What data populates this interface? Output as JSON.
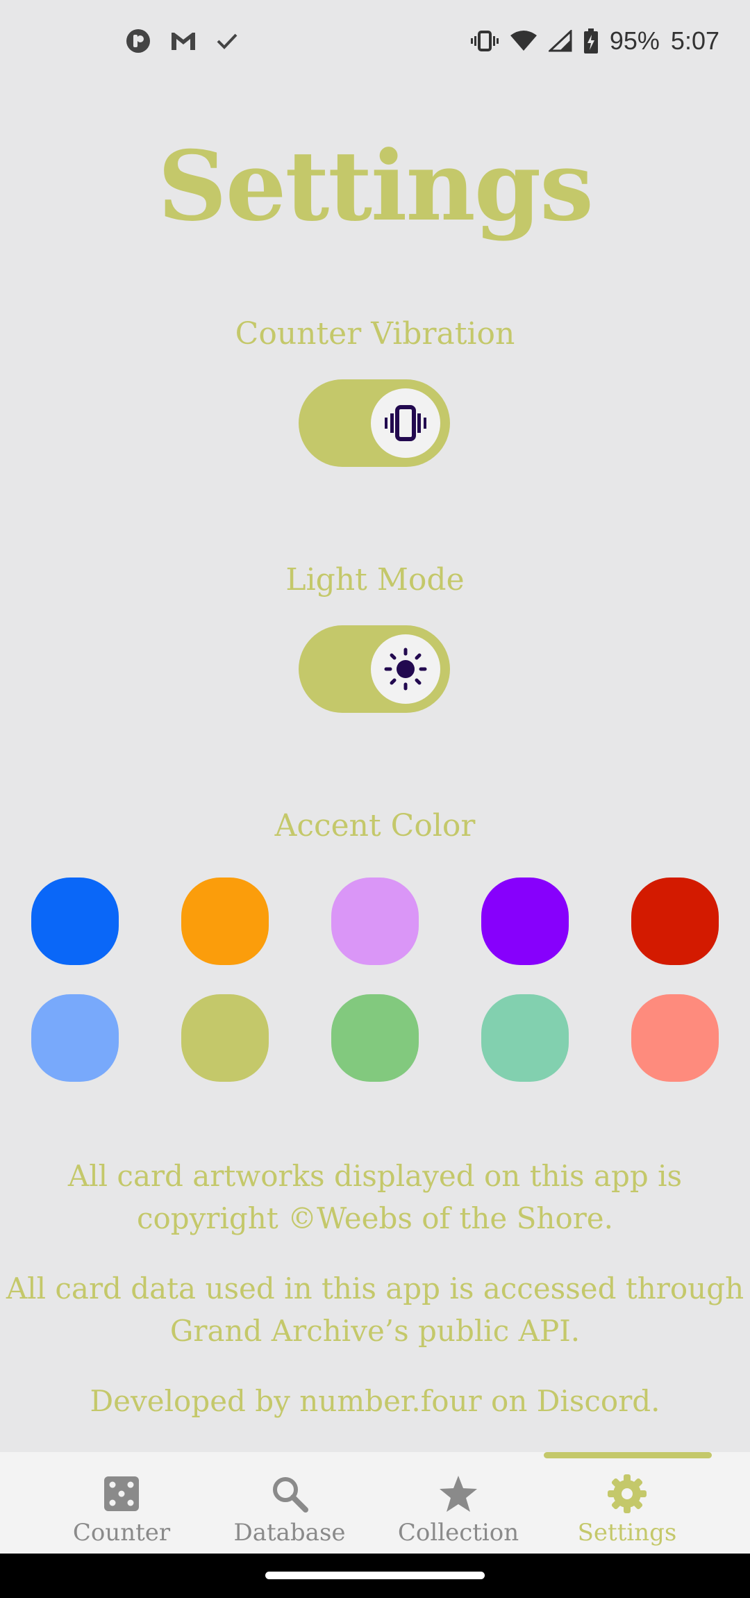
{
  "status_bar": {
    "battery": "95%",
    "time": "5:07",
    "left_icons": [
      "podcast-app-icon",
      "gmail-icon",
      "check-icon"
    ],
    "right_icons": [
      "vibrate-icon",
      "wifi-icon",
      "cell-signal-icon",
      "battery-charging-icon"
    ]
  },
  "page": {
    "title": "Settings"
  },
  "settings": {
    "vibration": {
      "label": "Counter Vibration",
      "enabled": true,
      "icon": "vibrate-icon"
    },
    "light_mode": {
      "label": "Light Mode",
      "enabled": true,
      "icon": "sun-icon"
    }
  },
  "accent": {
    "label": "Accent Color",
    "colors": [
      [
        "#0a67f8",
        "#fb9d0b",
        "#da96f7",
        "#8700fc",
        "#d31a00"
      ],
      [
        "#78a9fb",
        "#c4c86a",
        "#82c97e",
        "#82d0af",
        "#fe8b7d"
      ]
    ],
    "selected": "#c4c86a"
  },
  "footer": {
    "line1a": "All card artworks displayed on this app is",
    "line1b": "copyright ©Weebs of the Shore.",
    "line2a": "All card data used in this app is accessed through",
    "line2b": "Grand Archive’s public API.",
    "line3": "Developed by number.four on Discord."
  },
  "nav": {
    "active_color": "#c4c86a",
    "inactive_color": "#8a8a8a",
    "items": [
      {
        "label": "Counter",
        "icon": "dice-icon",
        "active": false
      },
      {
        "label": "Database",
        "icon": "search-icon",
        "active": false
      },
      {
        "label": "Collection",
        "icon": "star-icon",
        "active": false
      },
      {
        "label": "Settings",
        "icon": "gear-icon",
        "active": true
      }
    ]
  }
}
